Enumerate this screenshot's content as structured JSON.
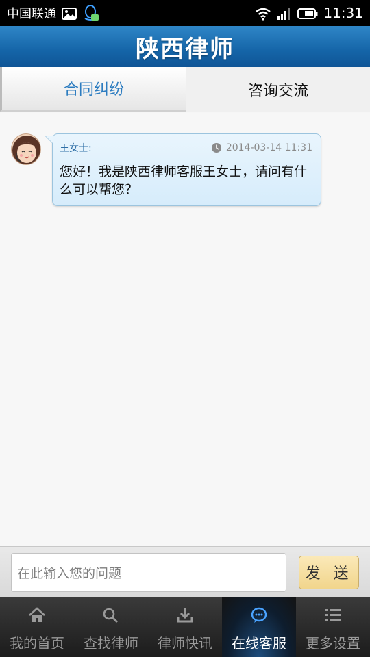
{
  "statusbar": {
    "carrier": "中国联通",
    "time": "11:31",
    "icons": [
      "image-icon",
      "qq-icon",
      "wifi-icon",
      "signal-icon",
      "battery-icon"
    ]
  },
  "header": {
    "title": "陕西律师"
  },
  "tabs": [
    {
      "label": "合同纠纷",
      "active": true
    },
    {
      "label": "咨询交流",
      "active": false
    }
  ],
  "chat": {
    "messages": [
      {
        "sender": "王女士:",
        "time": "2014-03-14 11:31",
        "text": "您好！我是陕西律师客服王女士，请问有什么可以帮您？"
      }
    ]
  },
  "composer": {
    "placeholder": "在此输入您的问题",
    "send_label": "发 送"
  },
  "bottom_nav": [
    {
      "label": "我的首页",
      "icon": "home-icon",
      "active": false
    },
    {
      "label": "查找律师",
      "icon": "search-icon",
      "active": false
    },
    {
      "label": "律师快讯",
      "icon": "download-icon",
      "active": false
    },
    {
      "label": "在线客服",
      "icon": "chat-icon",
      "active": true
    },
    {
      "label": "更多设置",
      "icon": "list-icon",
      "active": false
    }
  ],
  "colors": {
    "header_blue": "#1565a8",
    "active_tab_text": "#2c7cc0",
    "bubble_bg": "#d6ecfb"
  }
}
